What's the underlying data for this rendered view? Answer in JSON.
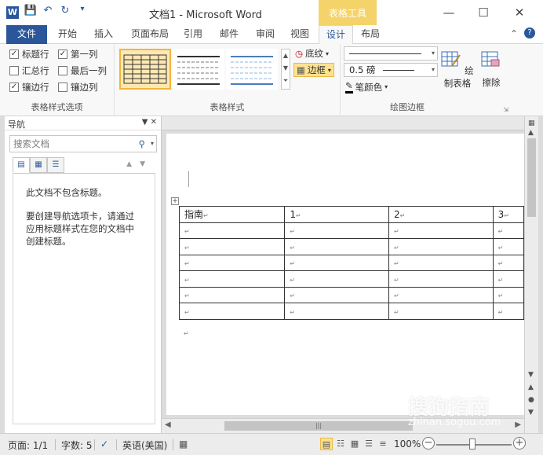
{
  "titlebar": {
    "app_icon": "W",
    "title": "文档1 - Microsoft Word",
    "context_group": "表格工具",
    "qat": [
      "save-icon",
      "undo-icon",
      "redo-icon",
      "customize-icon"
    ],
    "window_buttons": [
      "minimize",
      "maximize",
      "close"
    ]
  },
  "tabs": {
    "file": "文件",
    "items": [
      "开始",
      "插入",
      "页面布局",
      "引用",
      "邮件",
      "审阅",
      "视图",
      "设计",
      "布局"
    ],
    "active": "设计"
  },
  "ribbon": {
    "options_group": {
      "label": "表格样式选项",
      "checkboxes": [
        {
          "label": "标题行",
          "checked": true
        },
        {
          "label": "第一列",
          "checked": true
        },
        {
          "label": "汇总行",
          "checked": false
        },
        {
          "label": "最后一列",
          "checked": false
        },
        {
          "label": "镶边行",
          "checked": true
        },
        {
          "label": "镶边列",
          "checked": false
        }
      ]
    },
    "styles_group": {
      "label": "表格样式",
      "shading": "底纹",
      "borders": "边框"
    },
    "borders_group": {
      "label": "绘图边框",
      "weight": "0.5 磅",
      "pen_color": "笔颜色",
      "draw_table": "绘制表格",
      "eraser": "擦除"
    }
  },
  "nav": {
    "title": "导航",
    "search_placeholder": "搜索文档",
    "message1": "此文档不包含标题。",
    "message2": "要创建导航选项卡，请通过应用标题样式在您的文档中创建标题。"
  },
  "table": {
    "header": [
      "指南",
      "1",
      "2",
      "3"
    ],
    "empty_rows": 6
  },
  "status": {
    "page": "页面: 1/1",
    "words": "字数: 5",
    "language": "英语(美国)",
    "zoom": "100%"
  },
  "watermark": {
    "brand": "搜狗指南",
    "url": "zhinan.sogou.com"
  },
  "colors": {
    "word_blue": "#2b579a",
    "context_yellow": "#f5d36b",
    "highlight": "#fde28f"
  }
}
